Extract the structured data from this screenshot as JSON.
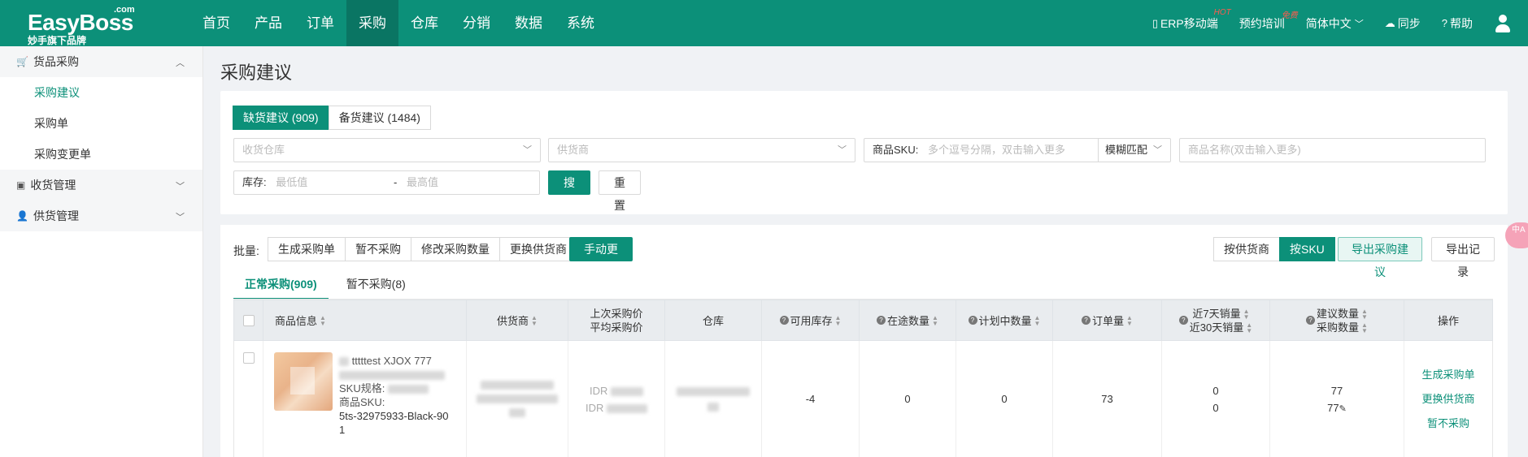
{
  "brand": {
    "name": "EasyBoss",
    "com": ".com",
    "subtitle": "妙手旗下品牌"
  },
  "nav": [
    {
      "label": "首页"
    },
    {
      "label": "产品"
    },
    {
      "label": "订单"
    },
    {
      "label": "采购",
      "active": true
    },
    {
      "label": "仓库"
    },
    {
      "label": "分销"
    },
    {
      "label": "数据"
    },
    {
      "label": "系统"
    }
  ],
  "topRight": {
    "mobile": "ERP移动端",
    "mobileBadge": "HOT",
    "training": "预约培训",
    "trainingBadge": "免费",
    "language": "简体中文",
    "sync": "同步",
    "help": "帮助"
  },
  "sidebar": {
    "group1": "货品采购",
    "group1Items": [
      "采购建议",
      "采购单",
      "采购变更单"
    ],
    "group2": "收货管理",
    "group3": "供货管理"
  },
  "page": {
    "title": "采购建议"
  },
  "tabs": {
    "shortage": "缺货建议 (909)",
    "stock": "备货建议 (1484)"
  },
  "filters": {
    "warehouse": "收货仓库",
    "supplier": "供货商",
    "skuLabel": "商品SKU:",
    "skuPlaceholder": "多个逗号分隔，双击输入更多",
    "matchMode": "模糊匹配",
    "namePlaceholder": "商品名称(双击输入更多)",
    "stockLabel": "库存:",
    "minPlaceholder": "最低值",
    "rangeSep": "-",
    "maxPlaceholder": "最高值",
    "search": "搜索",
    "reset": "重置"
  },
  "batch": {
    "label": "批量:",
    "actions": [
      "生成采购单",
      "暂不采购",
      "修改采购数量",
      "更换供货商"
    ],
    "manualUpdate": "手动更新",
    "bySupplier": "按供货商",
    "bySku": "按SKU",
    "exportSuggestion": "导出采购建议",
    "exportRecord": "导出记录"
  },
  "subTabs": {
    "normal": "正常采购(909)",
    "paused": "暂不采购(8)"
  },
  "table": {
    "headers": {
      "product": "商品信息",
      "supplier": "供货商",
      "lastPrice": "上次采购价",
      "avgPrice": "平均采购价",
      "warehouse": "仓库",
      "available": "可用库存",
      "inTransit": "在途数量",
      "planning": "计划中数量",
      "orderQty": "订单量",
      "sales7": "近7天销量",
      "sales30": "近30天销量",
      "suggestQty": "建议数量",
      "purchaseQty": "采购数量",
      "ops": "操作"
    },
    "row": {
      "titleFragment": "tttttest XJOX 777",
      "skuSpecLabel": "SKU规格:",
      "skuLabel": "商品SKU:",
      "sku": "5ts-32975933-Black-901",
      "priceFragment": "IDR",
      "available": "-4",
      "inTransit": "0",
      "planning": "0",
      "orderQty": "73",
      "sales7": "0",
      "sales30": "0",
      "suggestQty": "77",
      "purchaseQty": "77",
      "ops": [
        "生成采购单",
        "更换供货商",
        "暂不采购"
      ]
    }
  },
  "floatBadge": "中A"
}
